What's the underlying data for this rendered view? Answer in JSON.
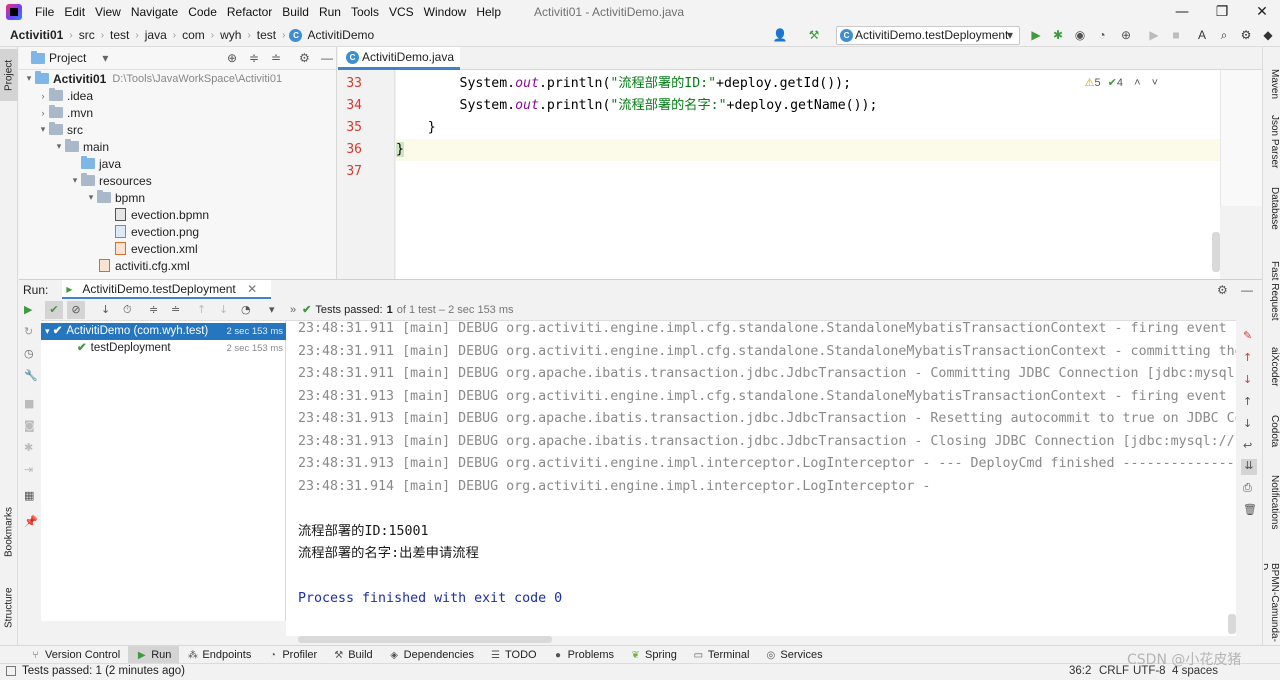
{
  "window": {
    "title": "Activiti01 - ActivitiDemo.java",
    "menu": [
      "File",
      "Edit",
      "View",
      "Navigate",
      "Code",
      "Refactor",
      "Build",
      "Run",
      "Tools",
      "VCS",
      "Window",
      "Help"
    ]
  },
  "breadcrumb": [
    "Activiti01",
    "src",
    "test",
    "java",
    "com",
    "wyh",
    "test",
    "ActivitiDemo"
  ],
  "run_config": "ActivitiDemo.testDeployment",
  "left_stripe": {
    "project": "Project",
    "bookmarks": "Bookmarks",
    "structure": "Structure"
  },
  "right_stripe": [
    "Maven",
    "Json Parser",
    "Database",
    "Fast Request",
    "aiXcoder",
    "Codota",
    "Notifications",
    "BPMN-Camunda-D"
  ],
  "project": {
    "header": "Project",
    "root_name": "Activiti01",
    "root_path": "D:\\Tools\\JavaWorkSpace\\Activiti01",
    "items": [
      ".idea",
      ".mvn",
      "src",
      "main",
      "java",
      "resources",
      "bpmn",
      "evection.bpmn",
      "evection.png",
      "evection.xml",
      "activiti.cfg.xml"
    ]
  },
  "editor": {
    "tab": "ActivitiDemo.java",
    "inspections": {
      "warnings": "5",
      "weak": "4"
    },
    "lines": [
      {
        "num": "33",
        "pre": "System.",
        "field": "out",
        "mid": ".println(",
        "str": "\"流程部署的ID:\"",
        "post": "+deploy.getId());"
      },
      {
        "num": "34",
        "pre": "System.",
        "field": "out",
        "mid": ".println(",
        "str": "\"流程部署的名字:\"",
        "post": "+deploy.getName());"
      },
      {
        "num": "35",
        "text": "}"
      },
      {
        "num": "36",
        "text": "}"
      },
      {
        "num": "37",
        "text": ""
      }
    ]
  },
  "run": {
    "label": "Run:",
    "tab": "ActivitiDemo.testDeployment",
    "status": {
      "passed": "Tests passed:",
      "count": "1",
      "detail": "of 1 test – 2 sec 153 ms"
    },
    "tests": [
      {
        "name": "ActivitiDemo (com.wyh.test)",
        "duration": "2 sec 153 ms"
      },
      {
        "name": "testDeployment",
        "duration": "2 sec 153 ms"
      }
    ],
    "log": [
      "23:48:31.911 [main] DEBUG org.activiti.engine.impl.cfg.standalone.StandaloneMybatisTransactionContext - firing event c",
      "23:48:31.911 [main] DEBUG org.activiti.engine.impl.cfg.standalone.StandaloneMybatisTransactionContext - committing the",
      "23:48:31.911 [main] DEBUG org.apache.ibatis.transaction.jdbc.JdbcTransaction - Committing JDBC Connection [jdbc:mysql",
      "23:48:31.913 [main] DEBUG org.activiti.engine.impl.cfg.standalone.StandaloneMybatisTransactionContext - firing event c",
      "23:48:31.913 [main] DEBUG org.apache.ibatis.transaction.jdbc.JdbcTransaction - Resetting autocommit to true on JDBC Co",
      "23:48:31.913 [main] DEBUG org.apache.ibatis.transaction.jdbc.JdbcTransaction - Closing JDBC Connection [jdbc:mysql://",
      "23:48:31.913 [main] DEBUG org.activiti.engine.impl.interceptor.LogInterceptor - --- DeployCmd finished --------------",
      "23:48:31.914 [main] DEBUG org.activiti.engine.impl.interceptor.LogInterceptor -"
    ],
    "output": [
      "流程部署的ID:15001",
      "流程部署的名字:出差申请流程"
    ],
    "exit": "Process finished with exit code 0"
  },
  "bottom_tools": [
    "Version Control",
    "Run",
    "Endpoints",
    "Profiler",
    "Build",
    "Dependencies",
    "TODO",
    "Problems",
    "Spring",
    "Terminal",
    "Services"
  ],
  "statusbar": {
    "message": "Tests passed: 1 (2 minutes ago)",
    "position": "36:2",
    "line_sep": "CRLF",
    "encoding": "UTF-8",
    "indent": "4 spaces",
    "watermark": "CSDN @小花皮猪"
  },
  "colors": {
    "accent": "#4083c9",
    "selection": "#2675bf",
    "line_number": "#d63b2e",
    "string": "#067d17",
    "pass": "#3d9b3d"
  }
}
